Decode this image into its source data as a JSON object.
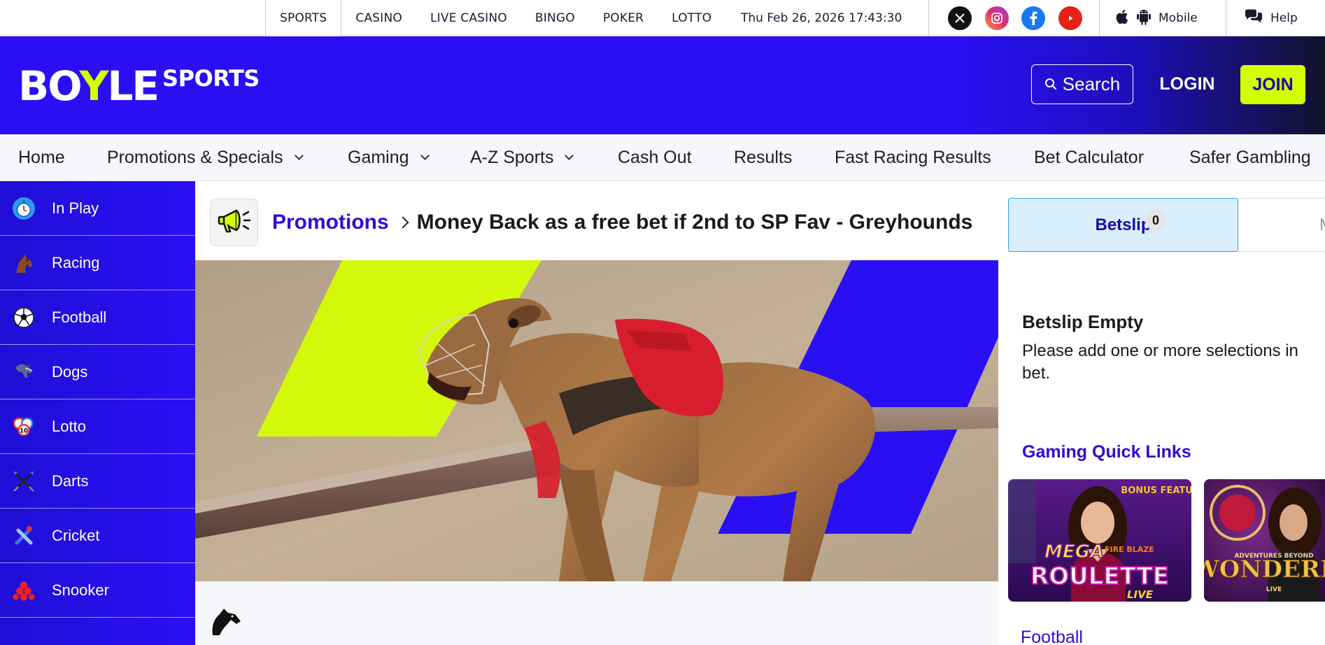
{
  "topbar": {
    "nav": [
      {
        "label": "SPORTS",
        "active": true
      },
      {
        "label": "CASINO"
      },
      {
        "label": "LIVE CASINO"
      },
      {
        "label": "BINGO"
      },
      {
        "label": "POKER"
      },
      {
        "label": "LOTTO"
      }
    ],
    "datetime": "Thu Feb 26, 2026 17:43:30",
    "social_icons": [
      "x-icon",
      "instagram-icon",
      "facebook-icon",
      "youtube-icon"
    ],
    "mobile_label": "Mobile",
    "help_label": "Help"
  },
  "header": {
    "logo_boyle_pre": "BO",
    "logo_boyle_y": "Y",
    "logo_boyle_post": "LE",
    "logo_sports": "SPORTS",
    "search_label": "Search",
    "login_label": "LOGIN",
    "join_label": "JOIN"
  },
  "mainnav": {
    "items": [
      {
        "label": "Home"
      },
      {
        "label": "Promotions & Specials",
        "dropdown": true
      },
      {
        "label": "Gaming",
        "dropdown": true
      },
      {
        "label": "A-Z Sports",
        "dropdown": true
      },
      {
        "label": "Cash Out"
      },
      {
        "label": "Results"
      },
      {
        "label": "Fast Racing Results"
      },
      {
        "label": "Bet Calculator"
      },
      {
        "label": "Safer Gambling"
      }
    ]
  },
  "sidebar": {
    "items": [
      {
        "label": "In Play",
        "icon": "stopwatch-icon"
      },
      {
        "label": "Racing",
        "icon": "horse-icon"
      },
      {
        "label": "Football",
        "icon": "football-icon"
      },
      {
        "label": "Dogs",
        "icon": "greyhound-icon"
      },
      {
        "label": "Lotto",
        "icon": "lotto-balls-icon"
      },
      {
        "label": "Darts",
        "icon": "darts-icon"
      },
      {
        "label": "Cricket",
        "icon": "cricket-icon"
      },
      {
        "label": "Snooker",
        "icon": "snooker-icon"
      }
    ]
  },
  "main": {
    "breadcrumb_link": "Promotions",
    "page_title": "Money Back as a free bet if 2nd to SP Fav - Greyhounds"
  },
  "betslip": {
    "tab_label": "Betslip",
    "count": "0",
    "second_tab_initial": "M",
    "empty_title": "Betslip Empty",
    "empty_text": "Please add one or more selections in bet.",
    "gaming_quick_links_title": "Gaming Quick Links",
    "tiles": [
      {
        "name": "mega-fire-blaze-roulette",
        "bonus_label": "BONUS FEATURE",
        "line1": "MEGA",
        "line2": "FIRE BLAZE",
        "line3": "ROULETTE",
        "line4": "LIVE"
      },
      {
        "name": "adventures-beyond-wonderland",
        "line1": "ADVENTURES BEYOND",
        "line2": "WONDERLA",
        "line3": "LIVE"
      }
    ],
    "football_link": "Football"
  },
  "colors": {
    "brand_blue": "#2a0ff5",
    "brand_lime": "#d4ff00",
    "link_blue": "#2a0fd8"
  }
}
